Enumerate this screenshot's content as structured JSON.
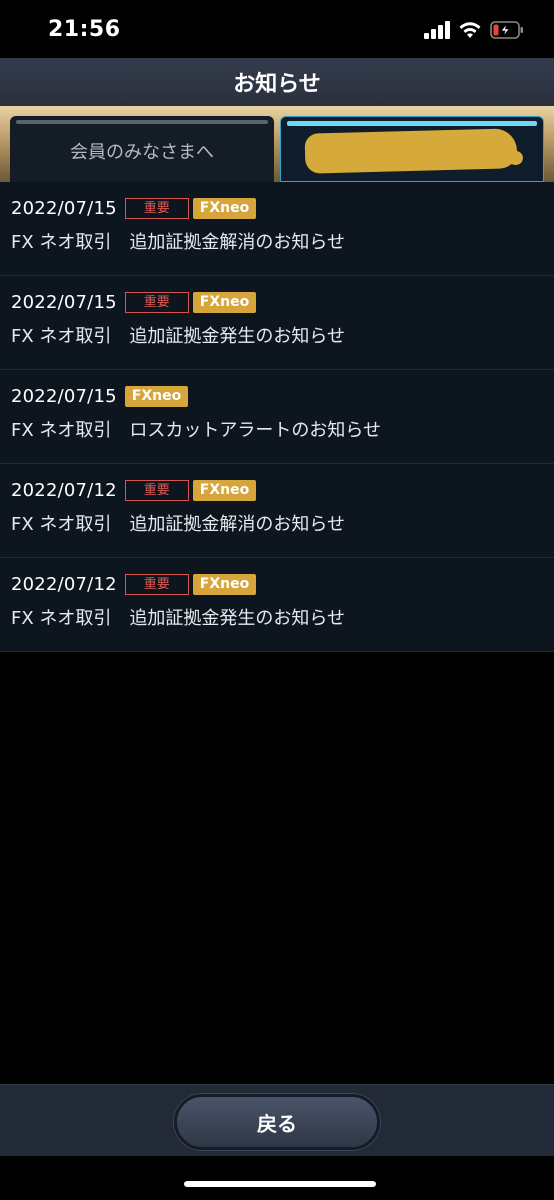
{
  "status_bar": {
    "time": "21:56",
    "icons": [
      "cellular-signal-icon",
      "wifi-icon",
      "battery-low-charging-icon"
    ],
    "battery_color": "#e5463c"
  },
  "header": {
    "title": "お知らせ"
  },
  "tabs": [
    {
      "label": "会員のみなさまへ",
      "selected": false
    },
    {
      "label": "",
      "selected": true,
      "redacted": true
    }
  ],
  "notices": [
    {
      "date": "2022/07/15",
      "important_label": "重要",
      "tag": "FXneo",
      "title": "FX ネオ取引　追加証拠金解消のお知らせ"
    },
    {
      "date": "2022/07/15",
      "important_label": "重要",
      "tag": "FXneo",
      "title": "FX ネオ取引　追加証拠金発生のお知らせ"
    },
    {
      "date": "2022/07/15",
      "important_label": "",
      "tag": "FXneo",
      "title": "FX ネオ取引　ロスカットアラートのお知らせ"
    },
    {
      "date": "2022/07/12",
      "important_label": "重要",
      "tag": "FXneo",
      "title": "FX ネオ取引　追加証拠金解消のお知らせ"
    },
    {
      "date": "2022/07/12",
      "important_label": "重要",
      "tag": "FXneo",
      "title": "FX ネオ取引　追加証拠金発生のお知らせ"
    }
  ],
  "footer": {
    "back_label": "戻る"
  },
  "colors": {
    "accent_gold": "#d6a53c",
    "important_red": "#d9534f",
    "active_tab_cyan": "#6fd8f4",
    "list_bg": "#0d161f"
  }
}
